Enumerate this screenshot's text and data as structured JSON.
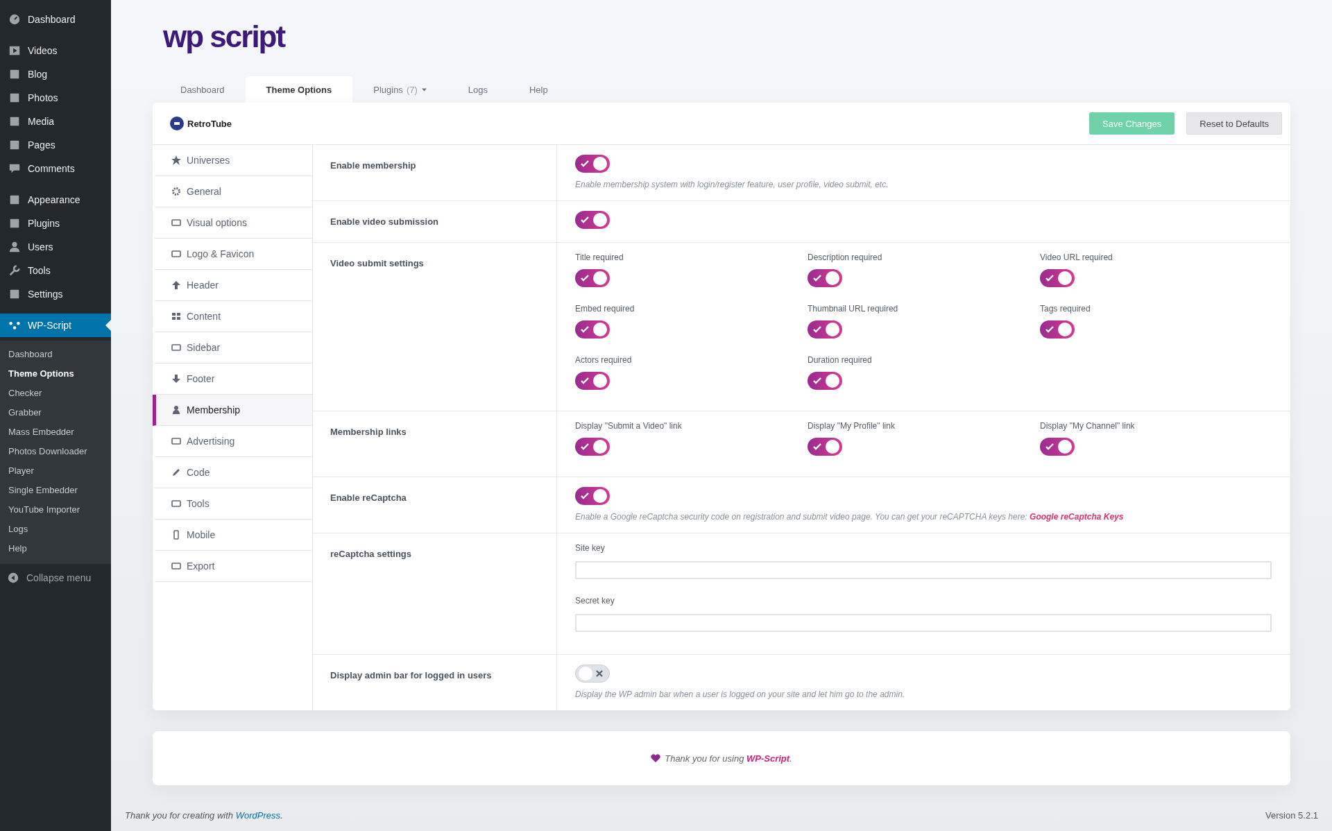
{
  "admin_menu": {
    "groups": [
      [
        {
          "label": "Dashboard",
          "selected": false
        }
      ],
      [
        {
          "label": "Videos",
          "selected": false
        },
        {
          "label": "Blog",
          "selected": false
        },
        {
          "label": "Photos",
          "selected": false
        },
        {
          "label": "Media",
          "selected": false
        },
        {
          "label": "Pages",
          "selected": false
        },
        {
          "label": "Comments",
          "selected": false
        }
      ],
      [
        {
          "label": "Appearance",
          "selected": false
        },
        {
          "label": "Plugins",
          "selected": false
        },
        {
          "label": "Users",
          "selected": false
        },
        {
          "label": "Tools",
          "selected": false
        },
        {
          "label": "Settings",
          "selected": false
        }
      ],
      [
        {
          "label": "WP-Script",
          "selected": true
        }
      ]
    ],
    "submenu": [
      {
        "label": "Dashboard",
        "selected": false
      },
      {
        "label": "Theme Options",
        "selected": true
      },
      {
        "label": "Checker",
        "selected": false
      },
      {
        "label": "Grabber",
        "selected": false
      },
      {
        "label": "Mass Embedder",
        "selected": false
      },
      {
        "label": "Photos Downloader",
        "selected": false
      },
      {
        "label": "Player",
        "selected": false
      },
      {
        "label": "Single Embedder",
        "selected": false
      },
      {
        "label": "YouTube Importer",
        "selected": false
      },
      {
        "label": "Logs",
        "selected": false
      },
      {
        "label": "Help",
        "selected": false
      }
    ],
    "collapse": "Collapse menu"
  },
  "logo": "wp script",
  "tabs": [
    {
      "label": "Dashboard",
      "selected": false
    },
    {
      "label": "Theme Options",
      "selected": true
    },
    {
      "label": "Plugins",
      "count": "(7)",
      "dropdown": true,
      "selected": false
    },
    {
      "label": "Logs",
      "selected": false
    },
    {
      "label": "Help",
      "selected": false
    }
  ],
  "panel": {
    "theme": "RetroTube",
    "buttons": {
      "save": "Save Changes",
      "reset": "Reset to Defaults"
    },
    "nav": [
      {
        "label": "Universes",
        "selected": false
      },
      {
        "label": "General",
        "selected": false
      },
      {
        "label": "Visual options",
        "selected": false
      },
      {
        "label": "Logo & Favicon",
        "selected": false
      },
      {
        "label": "Header",
        "selected": false
      },
      {
        "label": "Content",
        "selected": false
      },
      {
        "label": "Sidebar",
        "selected": false
      },
      {
        "label": "Footer",
        "selected": false
      },
      {
        "label": "Membership",
        "selected": true
      },
      {
        "label": "Advertising",
        "selected": false
      },
      {
        "label": "Code",
        "selected": false
      },
      {
        "label": "Tools",
        "selected": false
      },
      {
        "label": "Mobile",
        "selected": false
      },
      {
        "label": "Export",
        "selected": false
      }
    ],
    "settings": [
      {
        "label": "Enable membership",
        "kind": "toggle",
        "on": true,
        "description": {
          "text": "Enable membership system with login/register feature, user profile, video submit, etc."
        }
      },
      {
        "label": "Enable video submission",
        "kind": "toggle",
        "on": true
      },
      {
        "label": "Video submit settings",
        "kind": "grid",
        "items": [
          {
            "label": "Title required",
            "on": true
          },
          {
            "label": "Description required",
            "on": true
          },
          {
            "label": "Video URL required",
            "on": true
          },
          {
            "label": "Embed required",
            "on": true
          },
          {
            "label": "Thumbnail URL required",
            "on": true
          },
          {
            "label": "Tags required",
            "on": true
          },
          {
            "label": "Actors required",
            "on": true
          },
          {
            "label": "Duration required",
            "on": true
          }
        ]
      },
      {
        "label": "Membership links",
        "kind": "grid",
        "items": [
          {
            "label": "Display \"Submit a Video\" link",
            "on": true
          },
          {
            "label": "Display \"My Profile\" link",
            "on": true
          },
          {
            "label": "Display \"My Channel\" link",
            "on": true
          }
        ]
      },
      {
        "label": "Enable reCaptcha",
        "kind": "toggle",
        "on": true,
        "description": {
          "text": "Enable a Google reCaptcha security code on registration and submit video page. You can get your reCAPTCHA keys here: ",
          "link": "Google reCaptcha Keys"
        }
      },
      {
        "label": "reCaptcha settings",
        "kind": "fields",
        "fields": [
          {
            "label": "Site key"
          },
          {
            "label": "Secret key"
          }
        ]
      },
      {
        "label": "Display admin bar for logged in users",
        "kind": "toggle",
        "on": false,
        "description": {
          "text": "Display the WP admin bar when a user is logged on your site and let him go to the admin."
        }
      }
    ]
  },
  "thanks": {
    "text": "Thank you for using ",
    "link": "WP-Script",
    "after": "."
  },
  "wp_footer": {
    "text": "Thank you for creating with ",
    "link": "WordPress",
    "after": ".",
    "version": "Version 5.2.1"
  }
}
